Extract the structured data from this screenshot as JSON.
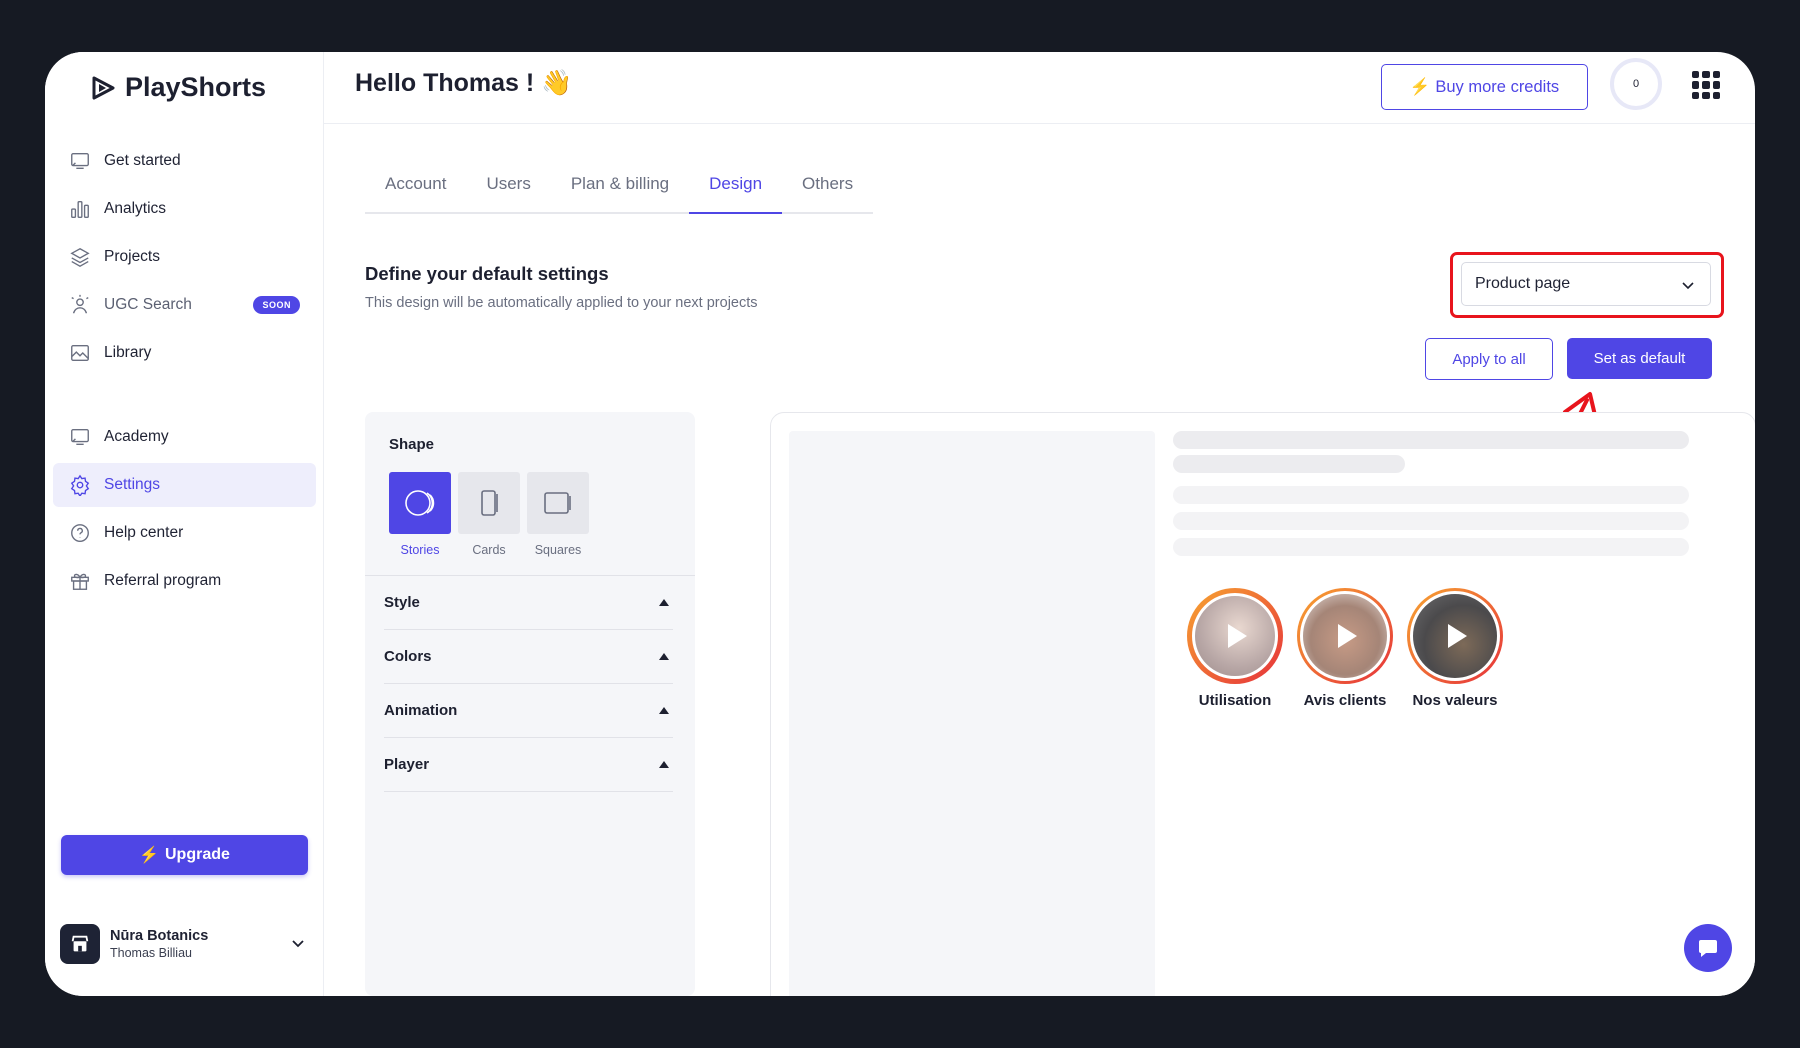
{
  "app": {
    "name": "PlayShorts"
  },
  "sidebar": {
    "items": [
      {
        "label": "Get started",
        "icon": "monitor-icon"
      },
      {
        "label": "Analytics",
        "icon": "bar-chart-icon"
      },
      {
        "label": "Projects",
        "icon": "layers-icon"
      },
      {
        "label": "UGC Search",
        "icon": "user-search-icon",
        "badge": "SOON"
      },
      {
        "label": "Library",
        "icon": "image-icon"
      }
    ],
    "items2": [
      {
        "label": "Academy",
        "icon": "monitor-icon"
      },
      {
        "label": "Settings",
        "icon": "gear-icon"
      },
      {
        "label": "Help center",
        "icon": "help-circle-icon"
      },
      {
        "label": "Referral program",
        "icon": "gift-icon"
      }
    ],
    "upgrade_label": "Upgrade",
    "account": {
      "name": "Nūra Botanics",
      "user": "Thomas Billiau"
    }
  },
  "header": {
    "greeting": "Hello Thomas ! 👋",
    "credits_button": "Buy more credits",
    "credits_count": "0"
  },
  "tabs": [
    "Account",
    "Users",
    "Plan & billing",
    "Design",
    "Others"
  ],
  "active_tab": "Design",
  "section": {
    "title": "Define your default settings",
    "subtitle": "This design will be automatically applied to your next projects"
  },
  "page_select": {
    "value": "Product page"
  },
  "actions": {
    "apply_all": "Apply to all",
    "set_default": "Set as default"
  },
  "panel": {
    "shape_title": "Shape",
    "shapes": [
      "Stories",
      "Cards",
      "Squares"
    ],
    "accordions": [
      "Style",
      "Colors",
      "Animation",
      "Player"
    ]
  },
  "preview": {
    "stories": [
      "Utilisation",
      "Avis clients",
      "Nos valeurs"
    ]
  },
  "colors": {
    "accent": "#4f46e5",
    "highlight": "#e8141c"
  }
}
